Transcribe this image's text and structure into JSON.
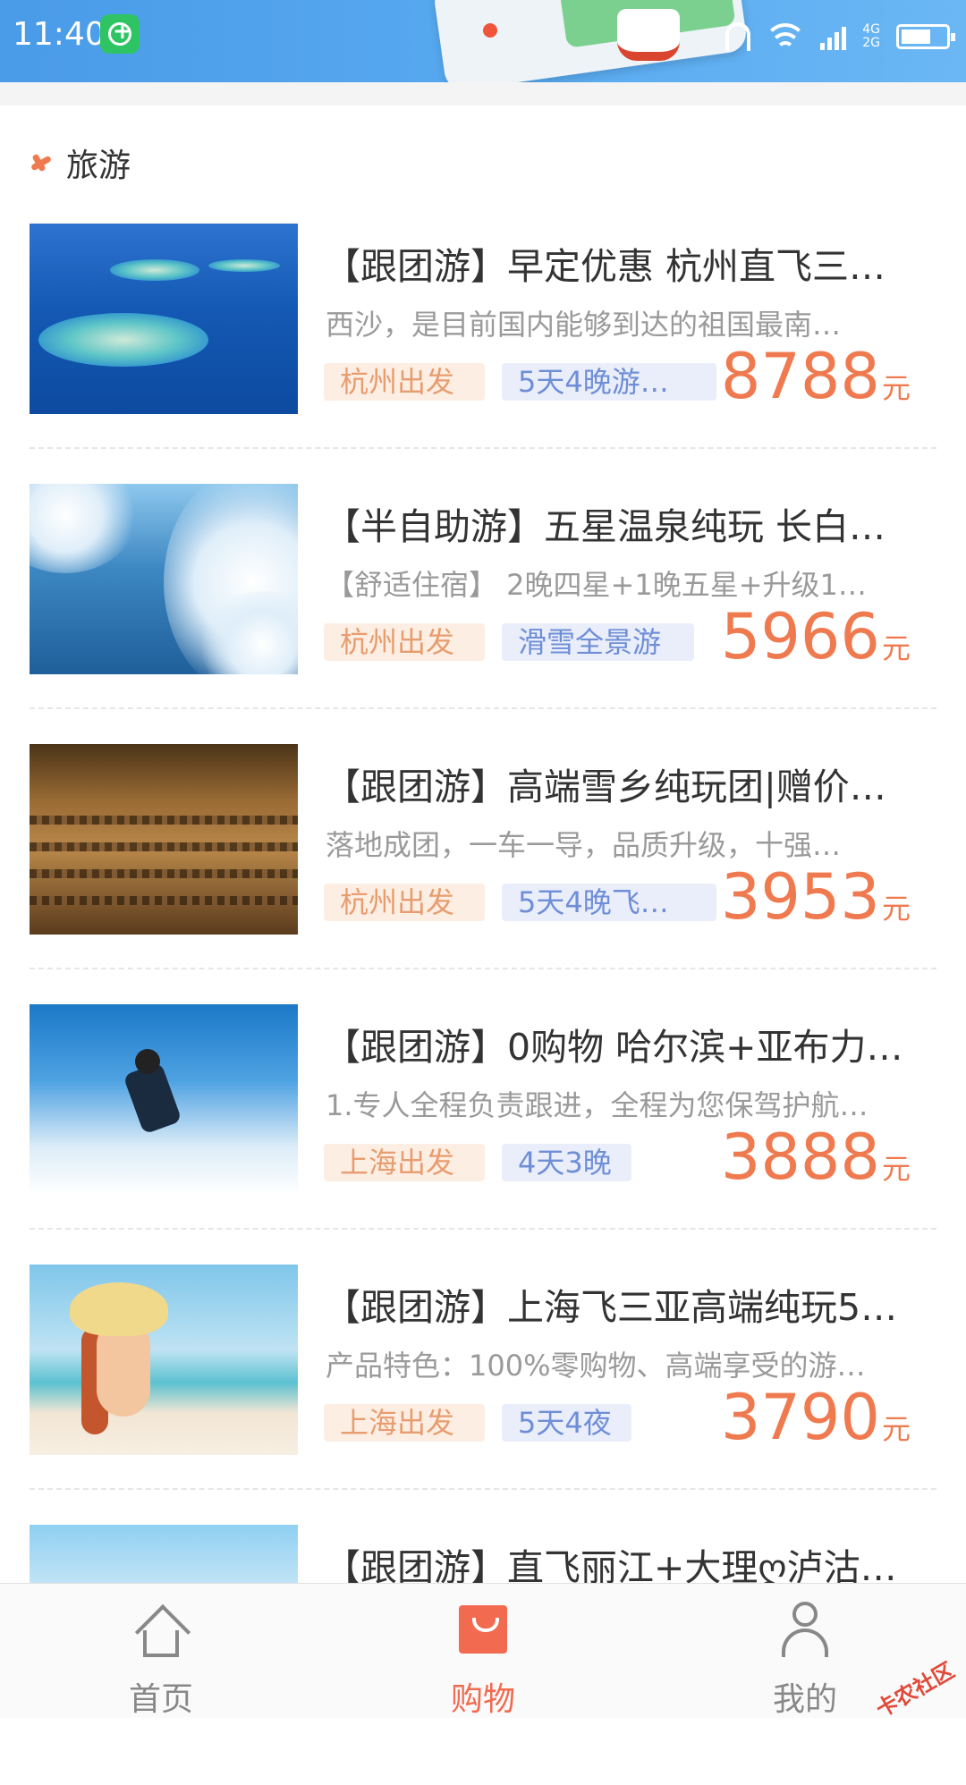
{
  "status_bar": {
    "time": "11:40",
    "network_top": "4G",
    "network_bottom": "2G",
    "icons": [
      "app-badge-icon",
      "headset-icon",
      "wifi-icon",
      "signal-icon",
      "battery-icon"
    ]
  },
  "section": {
    "icon": "plane-icon",
    "title": "旅游"
  },
  "items": [
    {
      "title": "【跟团游】早定优惠 杭州直飞三…",
      "desc": "西沙，是目前国内能够到达的祖国最南…",
      "origin": "杭州出发",
      "duration": "5天4晚游…",
      "price": "8788",
      "unit": "元",
      "image": "islands"
    },
    {
      "title": "【半自助游】五星温泉纯玩 长白…",
      "desc": "【舒适住宿】 2晚四星+1晚五星+升级1…",
      "origin": "杭州出发",
      "duration": "滑雪全景游",
      "price": "5966",
      "unit": "元",
      "image": "snow"
    },
    {
      "title": "【跟团游】高端雪乡纯玩团|赠价…",
      "desc": "落地成团，一车一导，品质升级，十强…",
      "origin": "杭州出发",
      "duration": "5天4晚飞…",
      "price": "3953",
      "unit": "元",
      "image": "warriors"
    },
    {
      "title": "【跟团游】0购物 哈尔滨+亚布力…",
      "desc": "1.专人全程负责跟进，全程为您保驾护航…",
      "origin": "上海出发",
      "duration": "4天3晚",
      "price": "3888",
      "unit": "元",
      "image": "ski"
    },
    {
      "title": "【跟团游】上海飞三亚高端纯玩5…",
      "desc": "产品特色：100%零购物、高端享受的游…",
      "origin": "上海出发",
      "duration": "5天4夜",
      "price": "3790",
      "unit": "元",
      "image": "beach"
    },
    {
      "title": "【跟团游】直飞丽江+大理ღ泸沽…",
      "desc": "",
      "origin": "",
      "duration": "",
      "price": "",
      "unit": "",
      "image": "city"
    }
  ],
  "bottom_nav": {
    "home": {
      "label": "首页",
      "icon": "home-icon"
    },
    "shop": {
      "label": "购物",
      "icon": "shopping-bag-icon",
      "active": true,
      "active_color": "#f26a4f"
    },
    "mine": {
      "label": "我的",
      "icon": "user-icon"
    }
  },
  "watermark": "卡农社区",
  "colors": {
    "status_bar": "#4a9be8",
    "price": "#f07a4f",
    "origin_tag_bg": "#fdeee3",
    "origin_tag_text": "#e79d6f",
    "duration_tag_bg": "#eaeefb",
    "duration_tag_text": "#6e8ed6"
  }
}
